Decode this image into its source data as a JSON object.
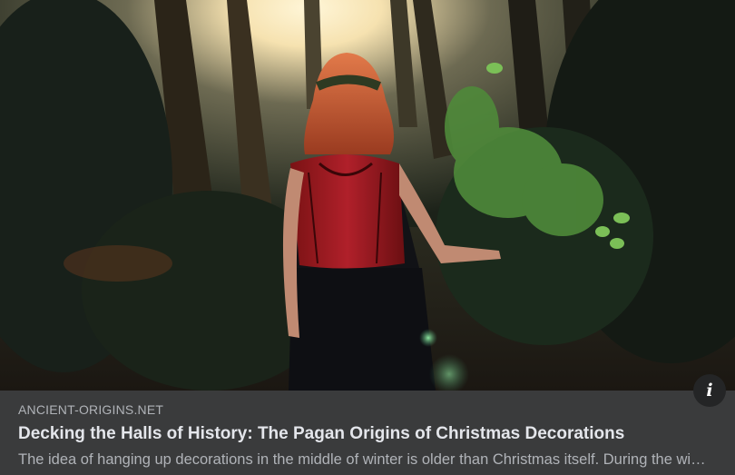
{
  "link_preview": {
    "image_alt": "Woman in red and black dress holding holly branches in a sunlit forest",
    "info_icon": "info-icon",
    "info_glyph": "i",
    "domain": "ANCIENT-ORIGINS.NET",
    "title": "Decking the Halls of History: The Pagan Origins of Christmas Decorations",
    "description": "The idea of hanging up decorations in the middle of winter is older than Christmas itself. During the winter months, pagans decorated their homes with evergreen plants"
  },
  "colors": {
    "card_background": "#3a3b3c",
    "title_text": "#e4e6eb",
    "secondary_text": "#b0b3b8",
    "info_button_bg": "#242526"
  }
}
